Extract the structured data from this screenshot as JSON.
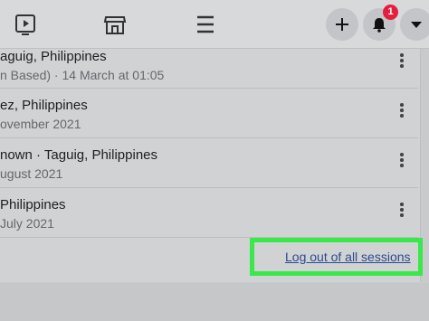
{
  "sessions": [
    {
      "location": "aguig, Philippines",
      "detail": "n Based) · 14 March at 01:05"
    },
    {
      "location": "ez, Philippines",
      "detail": "ovember 2021"
    },
    {
      "location": "nown · Taguig, Philippines",
      "detail": "ugust 2021"
    },
    {
      "location": "Philippines",
      "detail": "July 2021"
    }
  ],
  "notifications": {
    "count": "1"
  },
  "actions": {
    "logout_all_label": "Log out of all sessions"
  },
  "colors": {
    "highlight": "#39e84a",
    "badge": "#e41e3f",
    "link": "#2a4b8d"
  }
}
